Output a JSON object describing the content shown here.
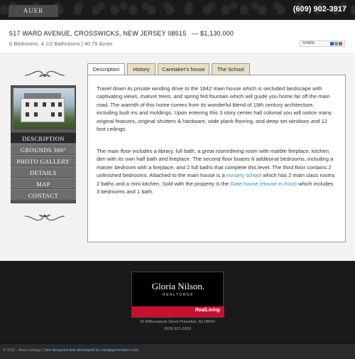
{
  "header": {
    "logo_text": "AUER LISTINGS",
    "phone": "(609) 902-3917"
  },
  "listing": {
    "address": "517 WARD AVENUE, CROSSWICKS, NEW JERSEY 08515",
    "price": "—  $1,130,000",
    "meta": "6 Bedrooms, 4 1/2 Bathrooms   |   40.75 Acres",
    "share_label": "SHARE"
  },
  "menu": {
    "items": [
      {
        "label": "DESCRIPTION"
      },
      {
        "label": "GROUNDS 360°"
      },
      {
        "label": "PHOTO GALLERY"
      },
      {
        "label": "DETAILS"
      },
      {
        "label": "MAP"
      },
      {
        "label": "CONTACT"
      }
    ]
  },
  "tabs": [
    {
      "label": "Description"
    },
    {
      "label": "History"
    },
    {
      "label": "Caretaker's house"
    },
    {
      "label": "The School"
    }
  ],
  "description": {
    "p1": "Travel down its private winding drive to the 1842 main house which is secluded landscape with captivating views, mature trees, and spring fed fountain which will guide you home far off the main road. The warmth of this home comes from its wonderful blend of 19th century architecture, including built ins and moldings. Upon entering this 3 story center hall colonial you will notice many original features, original shutters & hardware, wide plank flooring, and deep-set windows and 12 foot ceilings.",
    "p2_part1": "The main floor includes a library, full bath, a great room/dining room with marble fireplace, kitchen, den with its own half bath and fireplace. The second floor boasts 6 additional bedrooms, including a master bedroom with a fireplace, and 2 full baths that complete this level. The third floor contains 2 unfinished bedrooms. Attached to the main house is a ",
    "p2_link1": "nursery school",
    "p2_part2": " which has 2 main class rooms 2 baths and a mini kitchen. Sold with the property is the ",
    "p2_link2": "Gate house (House in front)",
    "p2_part3": " which includes 3 bedrooms and 1 bath."
  },
  "footer": {
    "brand_name": "Gloria Nilson.",
    "brand_sub": "REALTORS®",
    "brand_partner": "RealLiving",
    "address": "33 Witherspoon Street Princeton, NJ 08542",
    "phone": "(609) 921-2600",
    "copyright": "© 2011 - Auer Listings",
    "separator": " | ",
    "credit": "Site designed and developed by candpgeneration.com"
  },
  "colors": {
    "accent_link": "#2b8fbf",
    "tab_bg": "#e8dfc7",
    "brand_red": "#c8102e"
  }
}
